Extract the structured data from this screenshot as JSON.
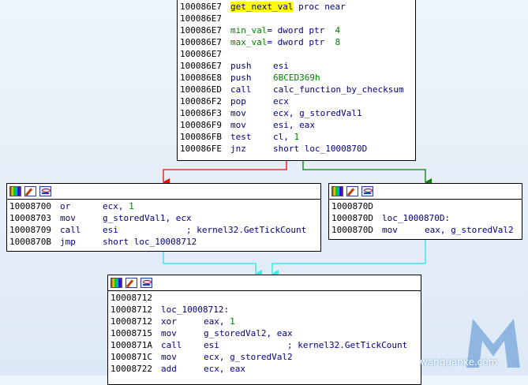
{
  "block_top": {
    "lines": [
      {
        "addr": "100086E7",
        "fname": "get_next_val",
        "rest": " proc near"
      },
      {
        "addr": "100086E7"
      },
      {
        "addr": "100086E7",
        "var": "min_val",
        "decl": "= dword ptr  ",
        "val": "4"
      },
      {
        "addr": "100086E7",
        "var": "max_val",
        "decl": "= dword ptr  ",
        "val": "8"
      },
      {
        "addr": "100086E7"
      },
      {
        "addr": "100086E7",
        "mn": "push",
        "op": "esi"
      },
      {
        "addr": "100086E8",
        "mn": "push",
        "num": "6BCED369h"
      },
      {
        "addr": "100086ED",
        "mn": "call",
        "op": "calc_function_by_checksum"
      },
      {
        "addr": "100086F2",
        "mn": "pop",
        "op": "ecx"
      },
      {
        "addr": "100086F3",
        "mn": "mov",
        "op": "ecx, g_storedVal1"
      },
      {
        "addr": "100086F9",
        "mn": "mov",
        "op": "esi, eax"
      },
      {
        "addr": "100086FB",
        "mn": "test",
        "op": "cl, ",
        "num": "1"
      },
      {
        "addr": "100086FE",
        "mn": "jnz",
        "op": "short loc_1000870D"
      }
    ]
  },
  "block_left": {
    "lines": [
      {
        "addr": "10008700",
        "mn": "or",
        "op": "ecx, ",
        "num": "1"
      },
      {
        "addr": "10008703",
        "mn": "mov",
        "op": "g_storedVal1, ecx"
      },
      {
        "addr": "10008709",
        "mn": "call",
        "op": "esi",
        "cmt": "             ; kernel32.GetTickCount"
      },
      {
        "addr": "1000870B",
        "mn": "jmp",
        "op": "short loc_10008712"
      }
    ]
  },
  "block_right": {
    "lines": [
      {
        "addr": "1000870D"
      },
      {
        "addr": "1000870D",
        "label": "loc_1000870D:"
      },
      {
        "addr": "1000870D",
        "mn": "mov",
        "op": "eax, g_storedVal2",
        "wide": true
      }
    ]
  },
  "block_bottom": {
    "lines": [
      {
        "addr": "10008712"
      },
      {
        "addr": "10008712",
        "label": "loc_10008712:"
      },
      {
        "addr": "10008712",
        "mn": "xor",
        "op": "eax, ",
        "num": "1"
      },
      {
        "addr": "10008715",
        "mn": "mov",
        "op": "g_storedVal2, eax"
      },
      {
        "addr": "1000871A",
        "mn": "call",
        "op": "esi",
        "cmt": "             ; kernel32.GetTickCount"
      },
      {
        "addr": "1000871C",
        "mn": "mov",
        "op": "ecx, g_storedVal2"
      },
      {
        "addr": "10008722",
        "mn": "add",
        "op": "ecx, eax"
      }
    ]
  },
  "watermark": {
    "text": "wanquanke.com"
  },
  "colors": {
    "edge_false": "#ff0000",
    "edge_true": "#008000",
    "edge_flow": "#3fe8ee",
    "watermark": "#4c8ad0"
  }
}
